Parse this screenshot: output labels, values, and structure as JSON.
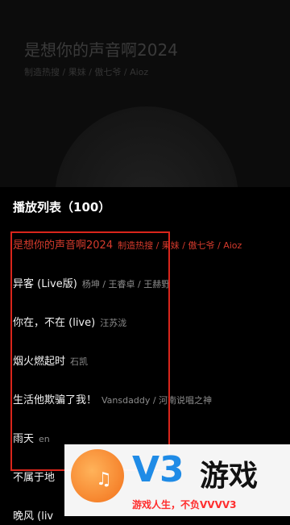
{
  "now_playing": {
    "title": "是想你的声音啊2024",
    "artist": "制造热搜 / 果妹 / 傲七爷 / Aioz"
  },
  "playlist": {
    "title": "播放列表（100）",
    "items": [
      {
        "song": "是想你的声音啊2024",
        "artist": "制造热搜 / 果妹 / 傲七爷 / Aioz",
        "active": true
      },
      {
        "song": "异客 (Live版)",
        "artist": "杨坤 / 王睿卓 / 王赫野"
      },
      {
        "song": "你在，不在 (live)",
        "artist": "汪苏泷"
      },
      {
        "song": "烟火燃起时",
        "artist": "石凯"
      },
      {
        "song": "生活他欺骗了我！",
        "artist": "Vansdaddy / 河南说唱之神"
      },
      {
        "song": "雨天",
        "artist": "en"
      },
      {
        "song": "不属于地",
        "artist": ""
      },
      {
        "song": "晚风 (liv",
        "artist": ""
      }
    ]
  },
  "watermark": {
    "brand": "V3",
    "brand2": "游戏",
    "slogan": "游戏人生，不负VVVV3",
    "note_icon": "music-note-icon"
  },
  "colors": {
    "active": "#d43a2c",
    "highlight_border": "#d9251b",
    "watermark_blue": "#1f8be6",
    "watermark_orange": "#f2701a"
  }
}
